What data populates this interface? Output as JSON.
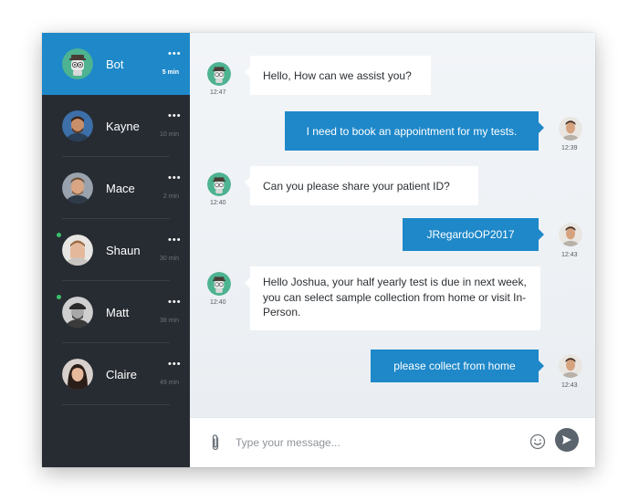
{
  "contacts": [
    {
      "name": "Bot",
      "time": "5 min",
      "menu": "•••",
      "online": false,
      "active": true
    },
    {
      "name": "Kayne",
      "time": "10 min",
      "menu": "•••",
      "online": false,
      "active": false
    },
    {
      "name": "Mace",
      "time": "2 min",
      "menu": "•••",
      "online": false,
      "active": false
    },
    {
      "name": "Shaun",
      "time": "30 min",
      "menu": "•••",
      "online": true,
      "active": false
    },
    {
      "name": "Matt",
      "time": "38 min",
      "menu": "•••",
      "online": true,
      "active": false
    },
    {
      "name": "Claire",
      "time": "49 min",
      "menu": "•••",
      "online": false,
      "active": false
    }
  ],
  "messages": [
    {
      "from": "bot",
      "text": "Hello, How can we assist you?",
      "time": "12:47"
    },
    {
      "from": "user",
      "text": "I need to book an appointment for my tests.",
      "time": "12:39"
    },
    {
      "from": "bot",
      "text": "Can you please share your patient ID?",
      "time": "12:40"
    },
    {
      "from": "user",
      "text": "JRegardoOP2017",
      "time": "12:43"
    },
    {
      "from": "bot",
      "text": "Hello Joshua, your half yearly test is due in next week, you can select sample collection from home or visit In-Person.",
      "time": "12:40"
    },
    {
      "from": "user",
      "text": "please collect from home",
      "time": "12:43"
    }
  ],
  "composer": {
    "placeholder": "Type your message...",
    "attach_icon": "paperclip-icon",
    "emoji_icon": "smiley-icon",
    "send_icon": "send-arrow-icon"
  },
  "colors": {
    "accent": "#1e88c9",
    "sidebar": "#272c33",
    "online": "#39c16c"
  }
}
